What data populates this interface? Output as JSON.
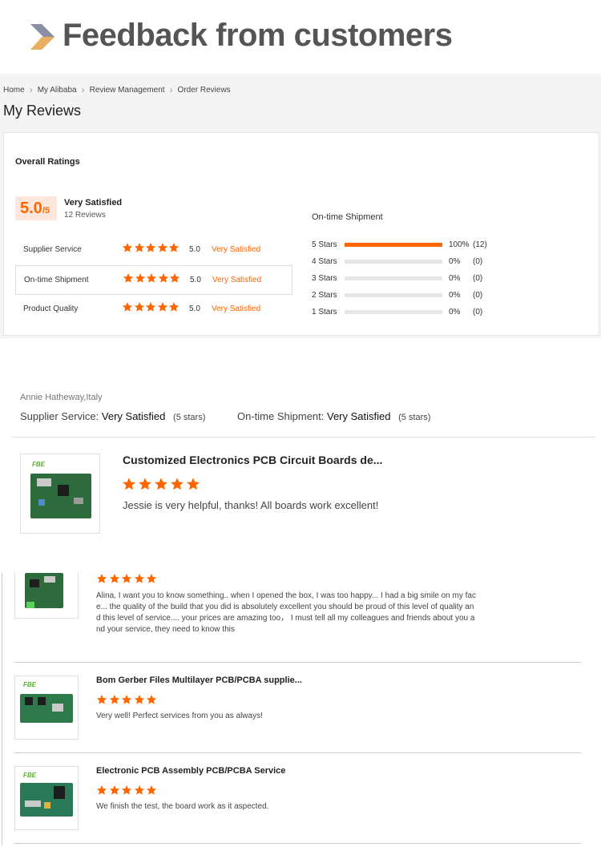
{
  "banner": {
    "title": "Feedback from customers"
  },
  "breadcrumb": [
    "Home",
    "My Alibaba",
    "Review Management",
    "Order Reviews"
  ],
  "page_title": "My Reviews",
  "overall": {
    "heading": "Overall Ratings",
    "score": "5.0",
    "out_of": "/5",
    "label": "Very Satisfied",
    "count": "12 Reviews",
    "metrics": [
      {
        "name": "Supplier Service",
        "score": "5.0",
        "text": "Very Satisfied",
        "stars": 5
      },
      {
        "name": "On-time Shipment",
        "score": "5.0",
        "text": "Very Satisfied",
        "stars": 5
      },
      {
        "name": "Product Quality",
        "score": "5.0",
        "text": "Very Satisfied",
        "stars": 5
      }
    ]
  },
  "shipment": {
    "title": "On-time Shipment",
    "rows": [
      {
        "label": "5 Stars",
        "pct": "100%",
        "count": "(12)",
        "fill": 1.0
      },
      {
        "label": "4 Stars",
        "pct": "0%",
        "count": "(0)",
        "fill": 0
      },
      {
        "label": "3 Stars",
        "pct": "0%",
        "count": "(0)",
        "fill": 0
      },
      {
        "label": "2 Stars",
        "pct": "0%",
        "count": "(0)",
        "fill": 0
      },
      {
        "label": "1 Stars",
        "pct": "0%",
        "count": "(0)",
        "fill": 0
      }
    ]
  },
  "review1": {
    "reviewer": "Annie Hatheway,Italy",
    "supplier_label": "Supplier Service:",
    "supplier_value": "Very Satisfied",
    "supplier_stars": "(5 stars)",
    "shipment_label": "On-time Shipment:",
    "shipment_value": "Very Satisfied",
    "shipment_stars": "(5 stars)",
    "product_title": "Customized Electronics PCB Circuit Boards de...",
    "comment": "Jessie is very helpful, thanks! All boards work excellent!",
    "logo": "FBE",
    "stars": 5
  },
  "list": [
    {
      "title": "",
      "comment_lines": [
        "Alina, I want you to know something.. when I opened the box, I was too happy... I had a big smile on my fac",
        "e... the quality of the build that you did is absolutely excellent you should be proud of this level of quality an",
        "d this level of service.... your prices are amazing too，  I must tell all my colleagues and friends about you a",
        "nd your service, they need to know this"
      ],
      "stars": 5
    },
    {
      "title": "Bom Gerber Files Multilayer PCB/PCBA supplie...",
      "comment_lines": [
        "Very well! Perfect services from you as always!"
      ],
      "logo": "FBE",
      "stars": 5
    },
    {
      "title": "Electronic PCB Assembly PCB/PCBA Service",
      "comment_lines": [
        "We finish the test, the board work as it aspected."
      ],
      "logo": "FBE",
      "stars": 5
    }
  ],
  "colors": {
    "accent": "#ff6600",
    "badge_bg": "#fde6dc",
    "pcb_green": "#2d6a3c"
  },
  "icons": {
    "star": "star-icon",
    "breadcrumb_sep": "chevron-right-icon",
    "banner": "double-chevron-icon"
  }
}
